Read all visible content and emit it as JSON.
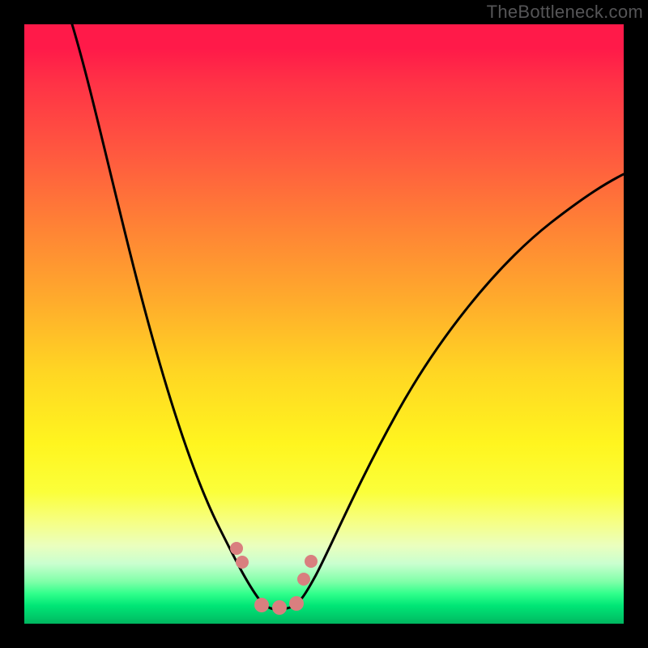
{
  "watermark": "TheBottleneck.com",
  "chart_data": {
    "type": "line",
    "title": "",
    "xlabel": "",
    "ylabel": "",
    "xlim": [
      0,
      1
    ],
    "ylim": [
      0,
      1
    ],
    "note": "Axes are unlabeled; values are normalized [0,1] estimates from pixel positions. Curve resembles a bottleneck well: y drops from ~1 at x≈0.08 to ~0 at x≈0.40, stays near 0 until x≈0.46, then rises to ~0.73 at x=1.",
    "series": [
      {
        "name": "bottleneck-curve",
        "x": [
          0.08,
          0.12,
          0.16,
          0.2,
          0.24,
          0.28,
          0.32,
          0.34,
          0.36,
          0.38,
          0.4,
          0.42,
          0.44,
          0.46,
          0.48,
          0.52,
          0.58,
          0.66,
          0.74,
          0.82,
          0.9,
          1.0
        ],
        "y": [
          1.0,
          0.88,
          0.75,
          0.62,
          0.49,
          0.36,
          0.23,
          0.17,
          0.11,
          0.06,
          0.03,
          0.02,
          0.02,
          0.03,
          0.05,
          0.12,
          0.23,
          0.37,
          0.49,
          0.59,
          0.67,
          0.73
        ]
      },
      {
        "name": "marker-dots",
        "x": [
          0.355,
          0.36,
          0.4,
          0.43,
          0.46,
          0.465,
          0.475
        ],
        "y": [
          0.125,
          0.105,
          0.03,
          0.03,
          0.035,
          0.075,
          0.105
        ]
      }
    ],
    "colors": {
      "curve": "#000000",
      "dots": "#d97f7f",
      "gradient_top": "#ff1a49",
      "gradient_mid": "#ffd623",
      "gradient_bottom": "#00b55f"
    }
  }
}
